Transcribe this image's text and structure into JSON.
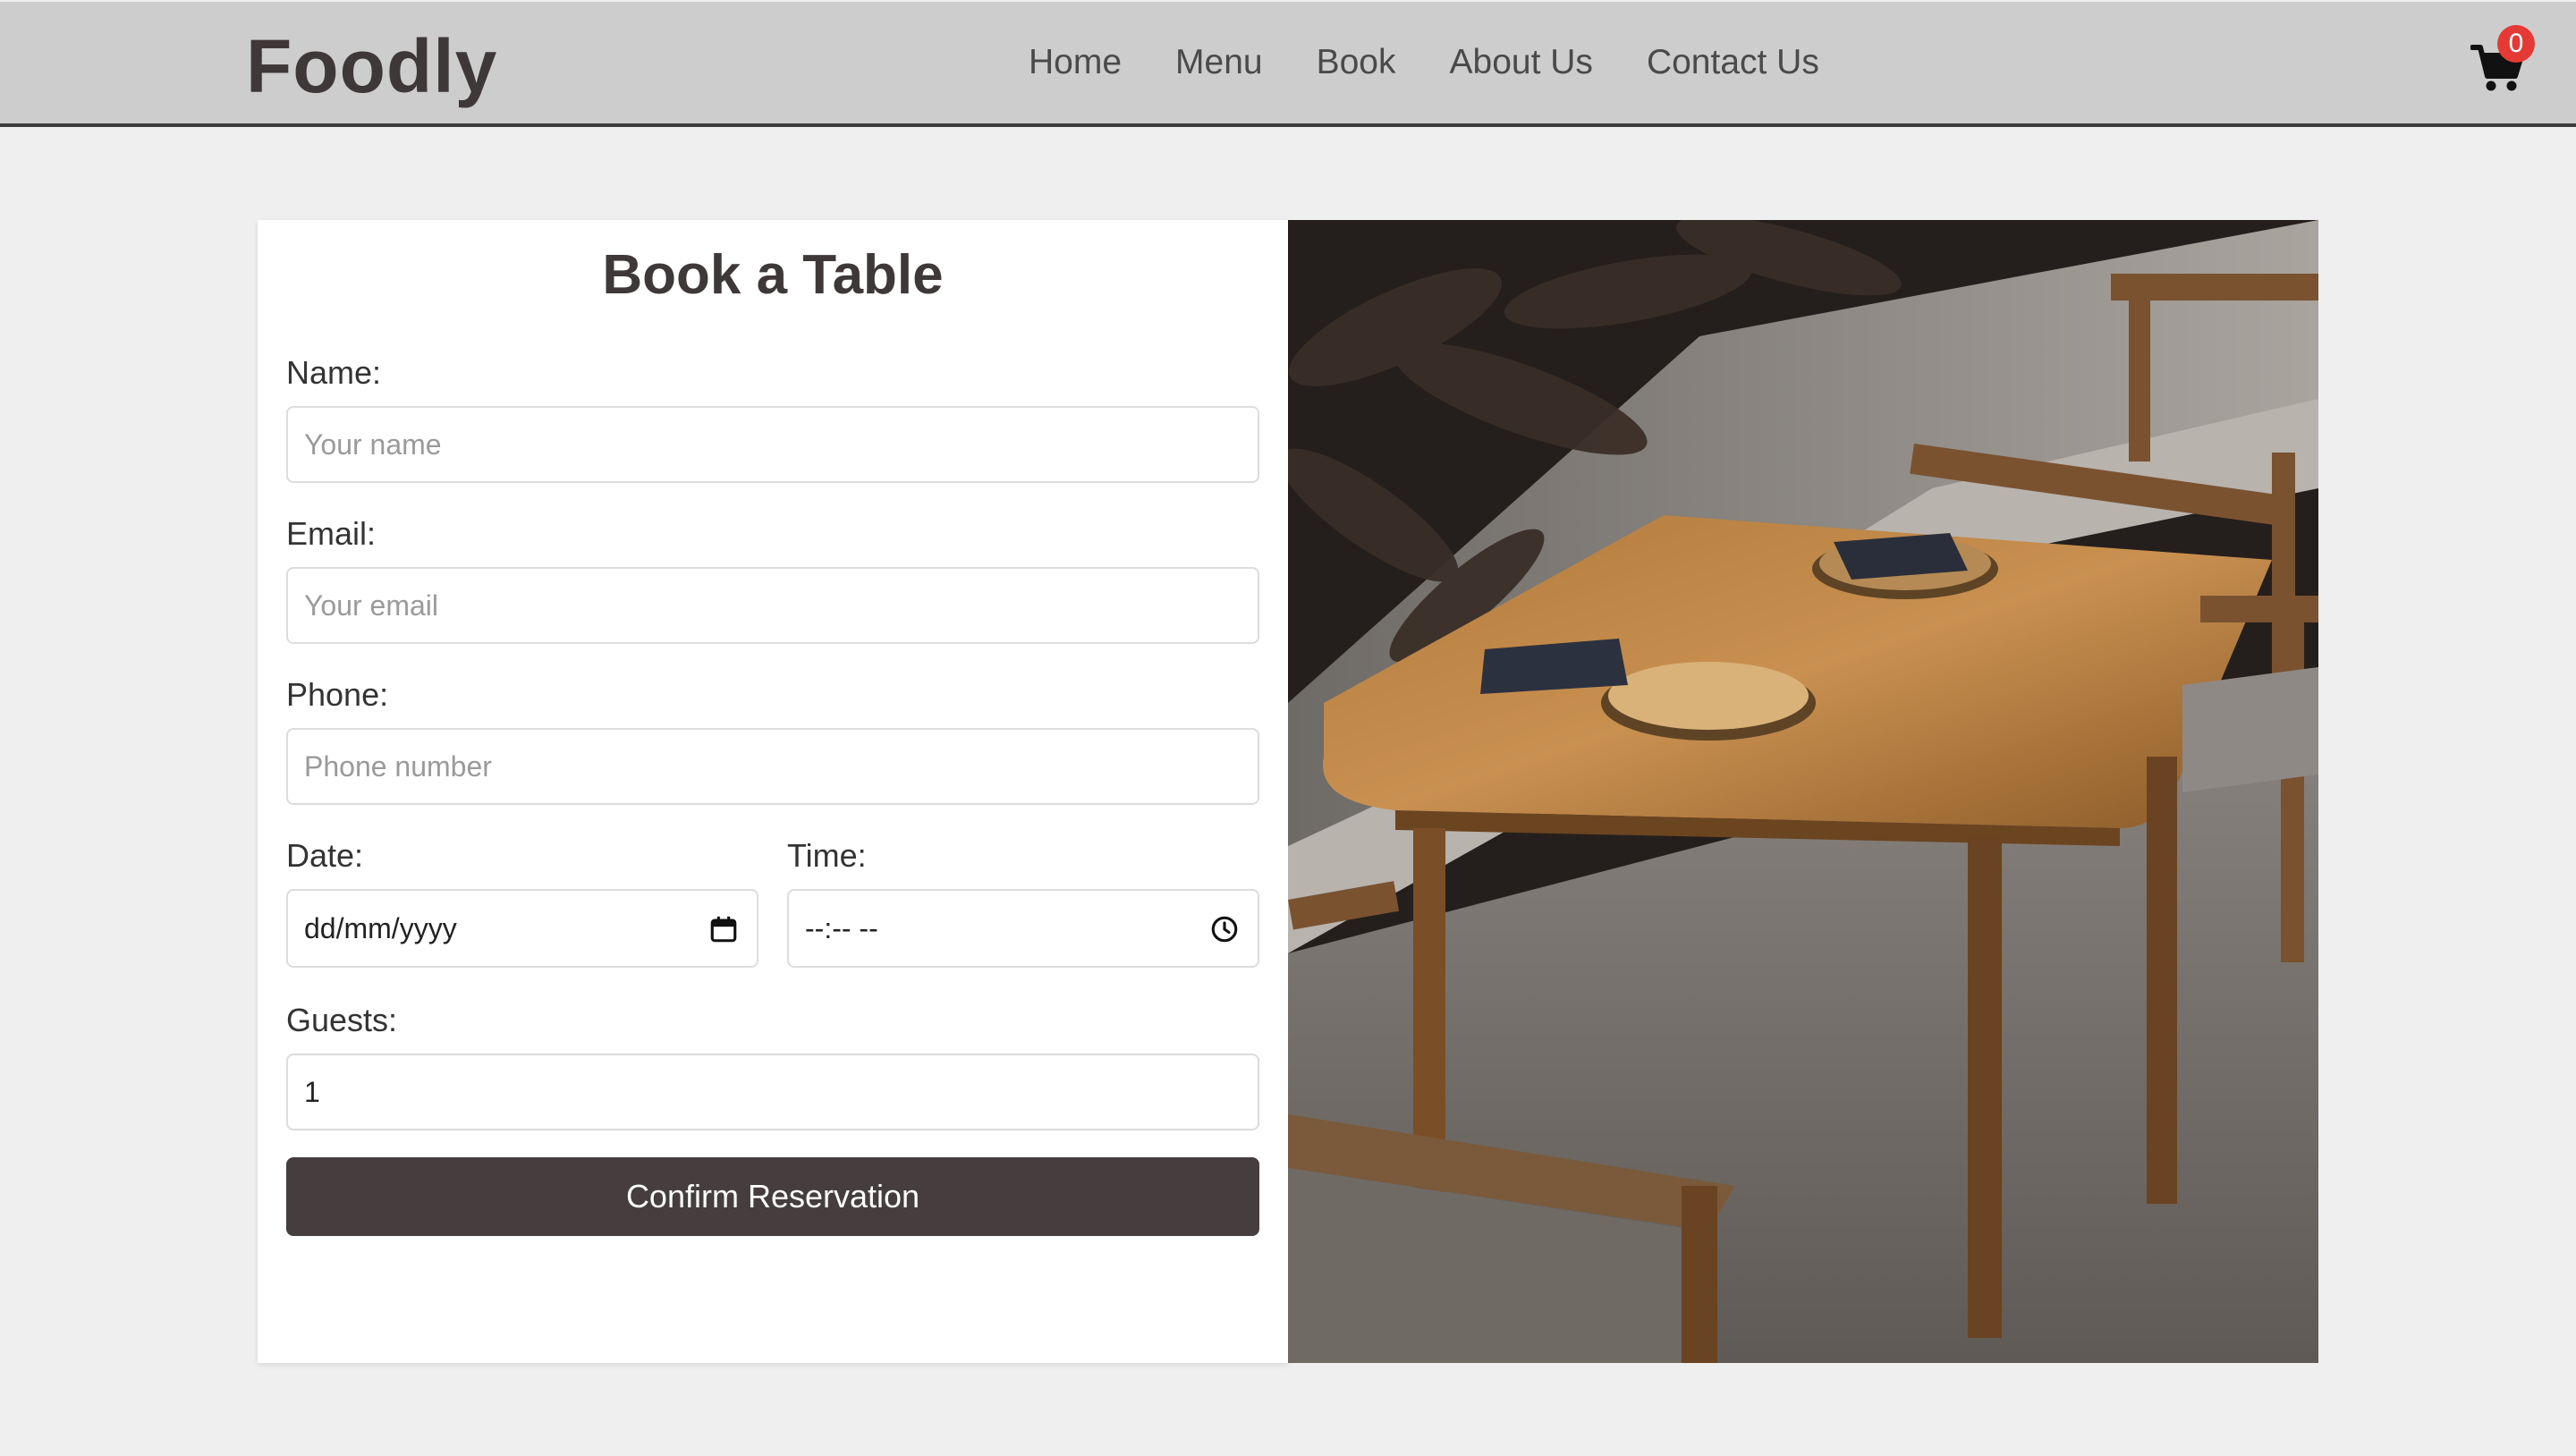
{
  "header": {
    "logo": "Foodly",
    "nav": [
      "Home",
      "Menu",
      "Book",
      "About Us",
      "Contact Us"
    ],
    "cart_count": "0",
    "cart_icon": "shopping-cart-icon",
    "badge_color": "#e53935"
  },
  "form": {
    "title": "Book a Table",
    "name_label": "Name:",
    "name_placeholder": "Your name",
    "email_label": "Email:",
    "email_placeholder": "Your email",
    "phone_label": "Phone:",
    "phone_placeholder": "Phone number",
    "date_label": "Date:",
    "date_value": "dd/mm/yyyy",
    "date_icon": "calendar-icon",
    "time_label": "Time:",
    "time_value": "--:-- --",
    "time_icon": "clock-icon",
    "guests_label": "Guests:",
    "guests_value": "1",
    "submit_label": "Confirm Reservation",
    "button_color": "#453d3e"
  },
  "photo": {
    "icon": "restaurant-table-photo"
  }
}
